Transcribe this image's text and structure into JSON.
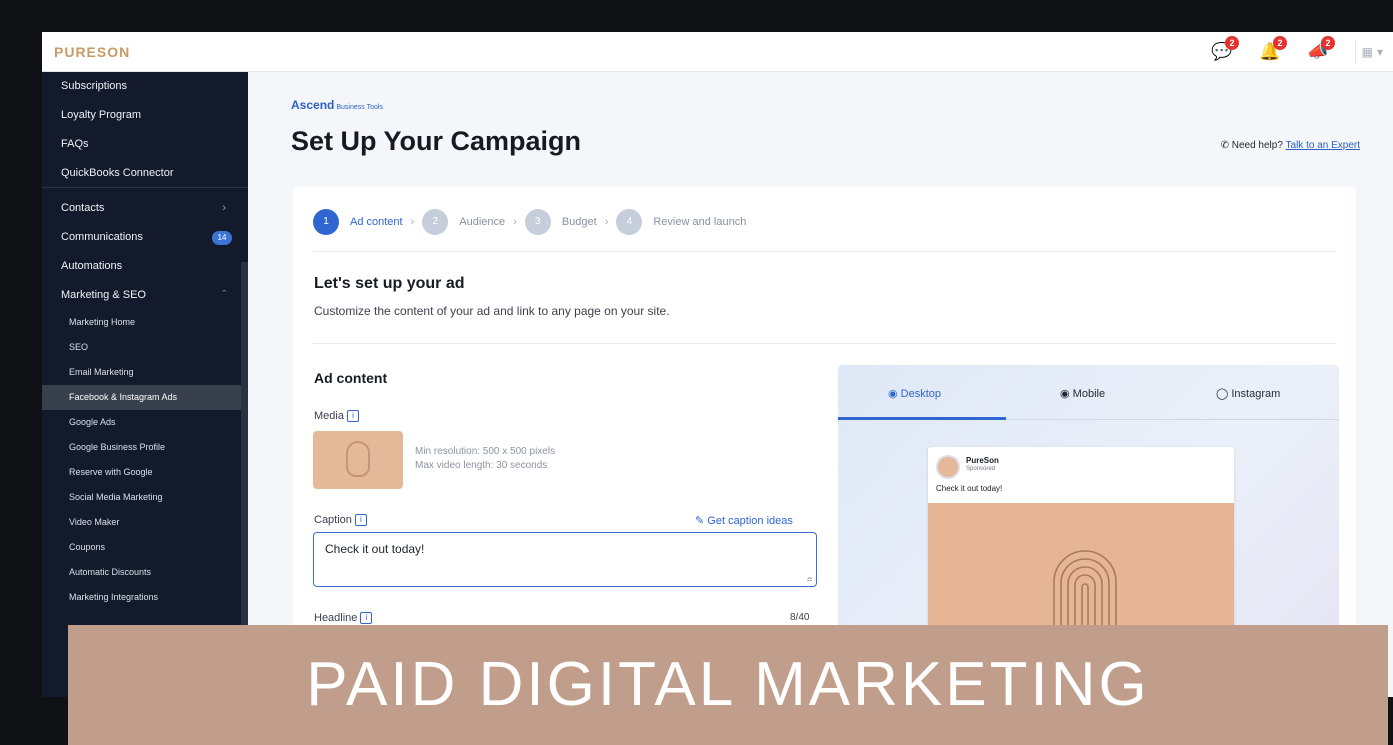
{
  "app": {
    "logo": "PURESON"
  },
  "topbar": {
    "icons": [
      {
        "name": "chat-icon",
        "badge": "2"
      },
      {
        "name": "bell-icon",
        "badge": "2"
      },
      {
        "name": "megaphone-icon",
        "badge": "2"
      }
    ]
  },
  "sidebar": {
    "items": [
      {
        "label": "Subscriptions"
      },
      {
        "label": "Loyalty Program"
      },
      {
        "label": "FAQs"
      },
      {
        "label": "QuickBooks Connector"
      },
      {
        "label": "Contacts"
      },
      {
        "label": "Communications",
        "count": "14"
      },
      {
        "label": "Automations"
      },
      {
        "label": "Marketing & SEO"
      }
    ],
    "sub_items": [
      "Marketing Home",
      "SEO",
      "Email Marketing",
      "Facebook & Instagram Ads",
      "Google Ads",
      "Google Business Profile",
      "Reserve with Google",
      "Social Media Marketing",
      "Video Maker",
      "Coupons",
      "Automatic Discounts",
      "Marketing Integrations"
    ],
    "active_sub": "Facebook & Instagram Ads"
  },
  "header": {
    "brand": "Ascend",
    "brand_sub": "Business Tools",
    "title": "Set Up Your Campaign",
    "help_text": "Need help?",
    "help_link": "Talk to an Expert"
  },
  "steps": [
    {
      "num": "1",
      "label": "Ad content",
      "current": true
    },
    {
      "num": "2",
      "label": "Audience"
    },
    {
      "num": "3",
      "label": "Budget"
    },
    {
      "num": "4",
      "label": "Review and launch"
    }
  ],
  "setup": {
    "title": "Let's set up your ad",
    "description": "Customize the content of your ad and link to any page on your site."
  },
  "ad_content": {
    "title": "Ad content",
    "media_label": "Media",
    "media_line1": "Min resolution: 500 x 500 pixels",
    "media_line2": "Max video length: 30 seconds",
    "caption_label": "Caption",
    "caption_link": "Get caption ideas",
    "caption_value": "Check it out today!",
    "headline_label": "Headline",
    "headline_count": "8/40"
  },
  "preview": {
    "tabs": [
      "Desktop",
      "Mobile",
      "Instagram"
    ],
    "post_name": "PureSon",
    "post_sponsored": "Sponsored",
    "post_text": "Check it out today!"
  },
  "banner": {
    "text": "PAID DIGITAL MARKETING"
  },
  "colors": {
    "accent": "#2f66cf",
    "sidebar": "#121a2c",
    "banner": "#c19d8b",
    "logo": "#c79a66"
  }
}
